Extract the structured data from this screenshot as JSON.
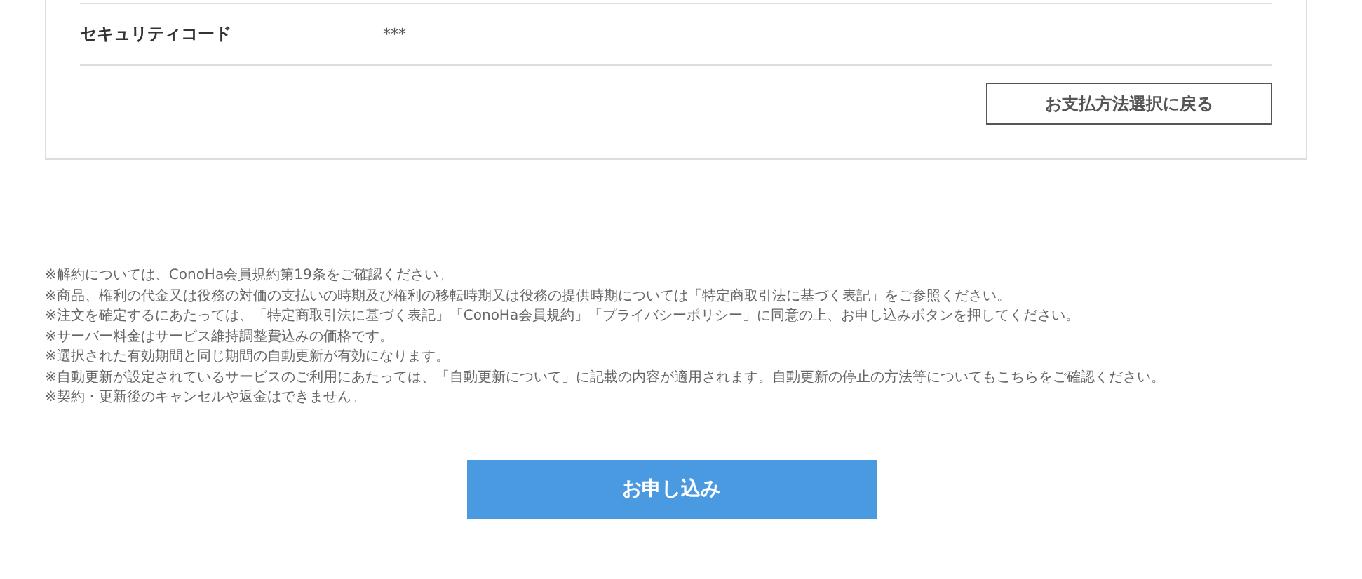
{
  "detail_rows": [
    {
      "label": "セキュリティコード",
      "value": "***"
    }
  ],
  "back_button": "お支払方法選択に戻る",
  "notes": [
    "※解約については、ConoHa会員規約第19条をご確認ください。",
    "※商品、権利の代金又は役務の対価の支払いの時期及び権利の移転時期又は役務の提供時期については「特定商取引法に基づく表記」をご参照ください。",
    "※注文を確定するにあたっては、「特定商取引法に基づく表記」「ConoHa会員規約」「プライバシーポリシー」に同意の上、お申し込みボタンを押してください。",
    "※サーバー料金はサービス維持調整費込みの価格です。",
    "※選択された有効期間と同じ期間の自動更新が有効になります。",
    "※自動更新が設定されているサービスのご利用にあたっては、「自動更新について」に記載の内容が適用されます。自動更新の停止の方法等についてもこちらをご確認ください。",
    "※契約・更新後のキャンセルや返金はできません。"
  ],
  "submit_button": "お申し込み"
}
